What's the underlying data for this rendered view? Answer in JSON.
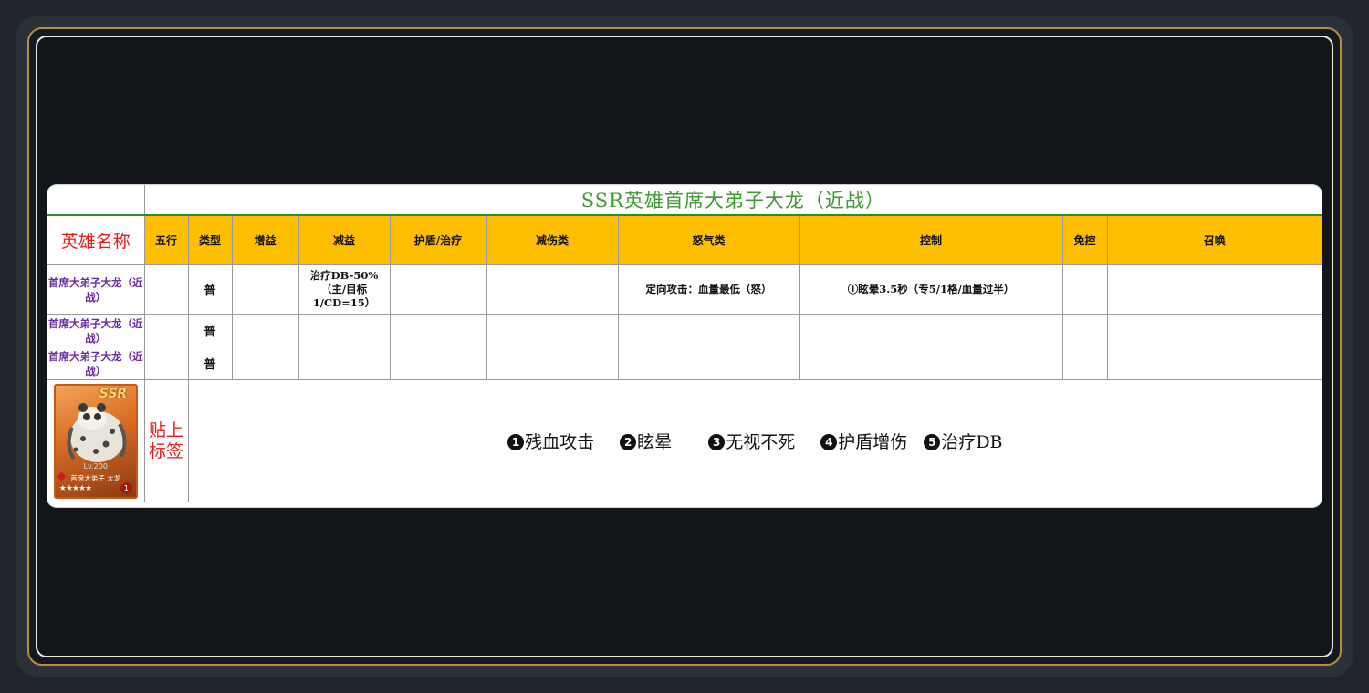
{
  "title": "SSR英雄首席大弟子大龙（近战）",
  "headers": {
    "hero_name": "英雄名称",
    "columns": [
      "五行",
      "类型",
      "增益",
      "减益",
      "护盾/治疗",
      "减伤类",
      "怒气类",
      "控制",
      "免控",
      "召唤"
    ]
  },
  "rows": [
    {
      "hero_name": "首席大弟子大龙（近战）",
      "element": "",
      "type": "普",
      "buff": "",
      "debuff": "治疗DB-50%（主/目标1/CD=15）",
      "shield_heal": "",
      "damage_reduction": "",
      "rage": "定向攻击：血量最低（怒）",
      "control": "①眩晕3.5秒（专5/1格/血量过半）",
      "control_immunity": "",
      "summon": ""
    },
    {
      "hero_name": "首席大弟子大龙（近战）",
      "element": "",
      "type": "普",
      "buff": "",
      "debuff": "",
      "shield_heal": "",
      "damage_reduction": "",
      "rage": "",
      "control": "",
      "control_immunity": "",
      "summon": ""
    },
    {
      "hero_name": "首席大弟子大龙（近战）",
      "element": "",
      "type": "普",
      "buff": "",
      "debuff": "",
      "shield_heal": "",
      "damage_reduction": "",
      "rage": "",
      "control": "",
      "control_immunity": "",
      "summon": ""
    }
  ],
  "hero_card": {
    "rarity": "SSR",
    "level": "Lv.200",
    "name": "首席大弟子 大龙",
    "stars": "★★★★★",
    "badge": "1"
  },
  "tag_label": "贴上标签",
  "tags": [
    {
      "num": "1",
      "text": "残血攻击"
    },
    {
      "num": "2",
      "text": "眩晕"
    },
    {
      "num": "3",
      "text": "无视不死"
    },
    {
      "num": "4",
      "text": "护盾增伤"
    },
    {
      "num": "5",
      "text": "治疗DB"
    }
  ],
  "colors": {
    "header_bg": "#fdbf00",
    "title_green": "#3d9b32",
    "hero_name_purple": "#6b2aa0",
    "label_red": "#e31c1c",
    "frame_gold": "#c08a3e"
  }
}
